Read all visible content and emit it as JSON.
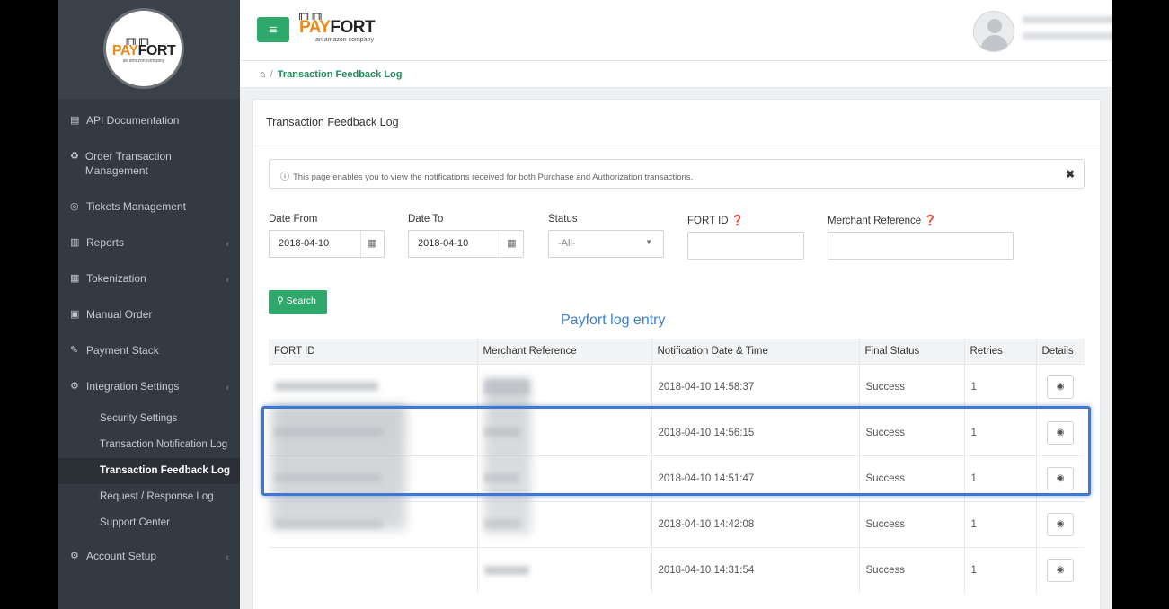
{
  "sidebar": {
    "logo": {
      "brand_pay": "PAY",
      "brand_fort": "FORT",
      "tagline": "an amazon company"
    },
    "items": [
      {
        "label": "API Documentation",
        "icon": "book-icon"
      },
      {
        "label": "Order Transaction Management",
        "icon": "order-icon"
      },
      {
        "label": "Tickets Management",
        "icon": "lifebuoy-icon"
      },
      {
        "label": "Reports",
        "icon": "chart-icon"
      },
      {
        "label": "Tokenization",
        "icon": "database-icon"
      },
      {
        "label": "Manual Order",
        "icon": "order-card-icon"
      },
      {
        "label": "Payment Stack",
        "icon": "pencil-icon"
      },
      {
        "label": "Integration Settings",
        "icon": "cogs-icon"
      },
      {
        "label": "Account Setup",
        "icon": "cogs-icon"
      }
    ],
    "submenu": [
      {
        "label": "Security Settings"
      },
      {
        "label": "Transaction Notification Log"
      },
      {
        "label": "Transaction Feedback Log",
        "active": true
      },
      {
        "label": "Request / Response Log"
      },
      {
        "label": "Support Center"
      }
    ]
  },
  "header": {
    "brand_pay": "PAY",
    "brand_fort": "FORT",
    "tagline": "an amazon company",
    "user_suffix": "\\"
  },
  "breadcrumb": {
    "current": "Transaction Feedback Log"
  },
  "panel": {
    "title": "Transaction Feedback Log",
    "alert": "This page enables you to view the notifications received for both Purchase and Authorization transactions.",
    "filters": {
      "date_from_label": "Date From",
      "date_from_value": "2018-04-10",
      "date_to_label": "Date To",
      "date_to_value": "2018-04-10",
      "status_label": "Status",
      "status_value": "-All-",
      "fort_id_label": "FORT ID",
      "merchant_ref_label": "Merchant Reference"
    },
    "search_label": "Search",
    "log_title": "Payfort log entry"
  },
  "table": {
    "headers": [
      "FORT ID",
      "Merchant Reference",
      "Notification Date & Time",
      "Final Status",
      "Retries",
      "Details"
    ],
    "rows": [
      {
        "date": "2018-04-10 14:58:37",
        "status": "Success",
        "retries": "1"
      },
      {
        "date": "2018-04-10 14:56:15",
        "status": "Success",
        "retries": "1"
      },
      {
        "date": "2018-04-10 14:51:47",
        "status": "Success",
        "retries": "1"
      },
      {
        "date": "2018-04-10 14:42:08",
        "status": "Success",
        "retries": "1"
      },
      {
        "date": "2018-04-10 14:31:54",
        "status": "Success",
        "retries": "1"
      }
    ]
  },
  "colors": {
    "accent_green": "#2fa86b",
    "sidebar_bg": "#333a41",
    "link_blue": "#3d7fcd",
    "highlight_blue": "#3f78d0"
  }
}
